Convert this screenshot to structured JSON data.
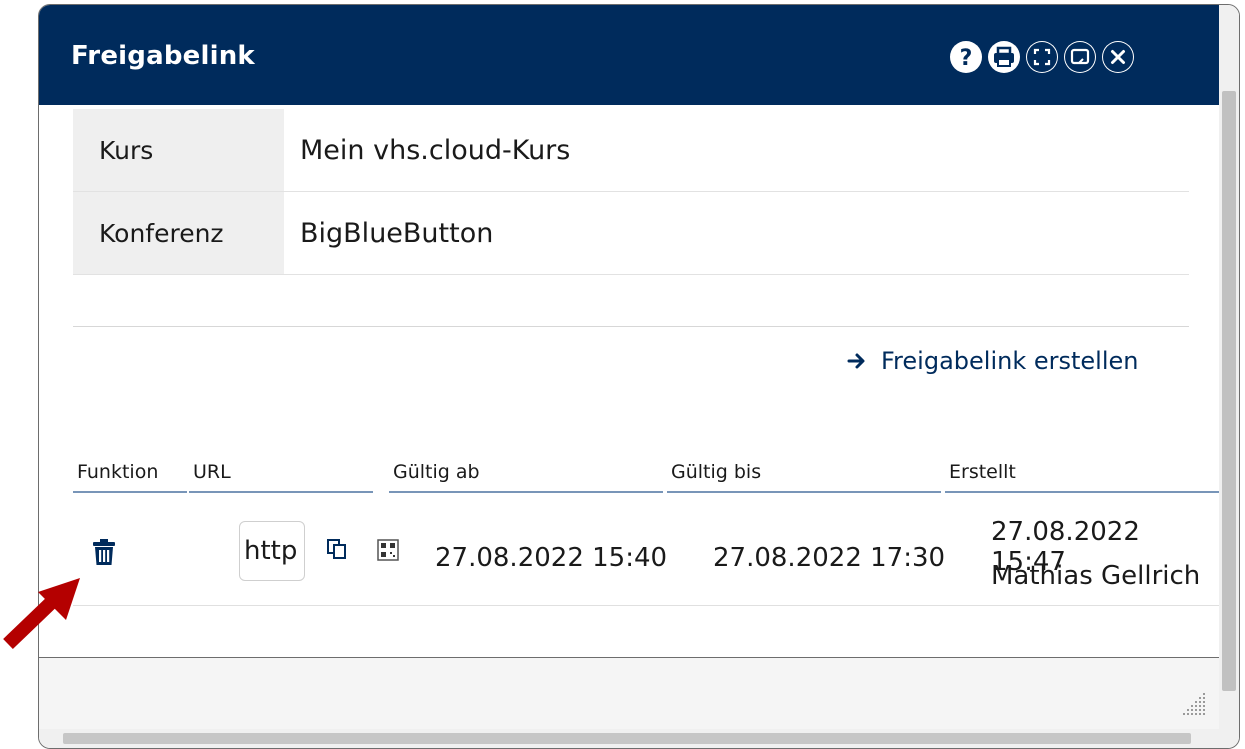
{
  "dialog": {
    "title": "Freigabelink",
    "toolbar_icons": [
      "help-icon",
      "print-icon",
      "fullscreen-icon",
      "window-icon",
      "close-icon"
    ]
  },
  "info": {
    "rows": [
      {
        "label": "Kurs",
        "value": "Mein vhs.cloud-Kurs"
      },
      {
        "label": "Konferenz",
        "value": "BigBlueButton"
      }
    ]
  },
  "actions": {
    "create_link": "Freigabelink erstellen"
  },
  "table": {
    "columns": [
      "Funktion",
      "URL",
      "Gültig ab",
      "Gültig bis",
      "Erstellt"
    ],
    "rows": [
      {
        "url": "http",
        "valid_from": "27.08.2022 15:40",
        "valid_to": "27.08.2022 17:30",
        "created_date": "27.08.2022 15:47",
        "created_by": "Mathias Gellrich"
      }
    ]
  },
  "colors": {
    "header_bg": "#002b5c",
    "accent": "#002b5c",
    "annotation_arrow": "#b40000"
  }
}
